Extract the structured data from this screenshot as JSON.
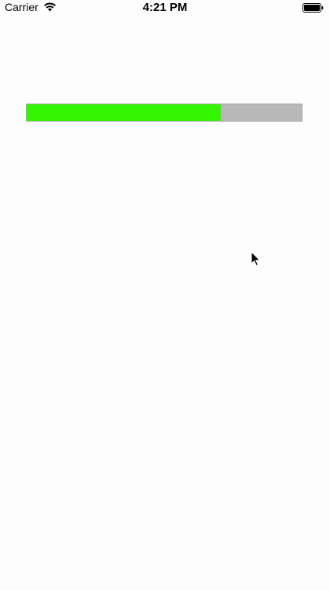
{
  "status_bar": {
    "carrier": "Carrier",
    "time": "4:21 PM",
    "wifi_icon": "wifi-icon",
    "battery_icon": "battery-full-icon"
  },
  "progress": {
    "value": 0.705,
    "fill_color": "#34f500",
    "track_color": "#b8b8b8"
  },
  "cursor": {
    "icon": "mouse-pointer-icon"
  }
}
